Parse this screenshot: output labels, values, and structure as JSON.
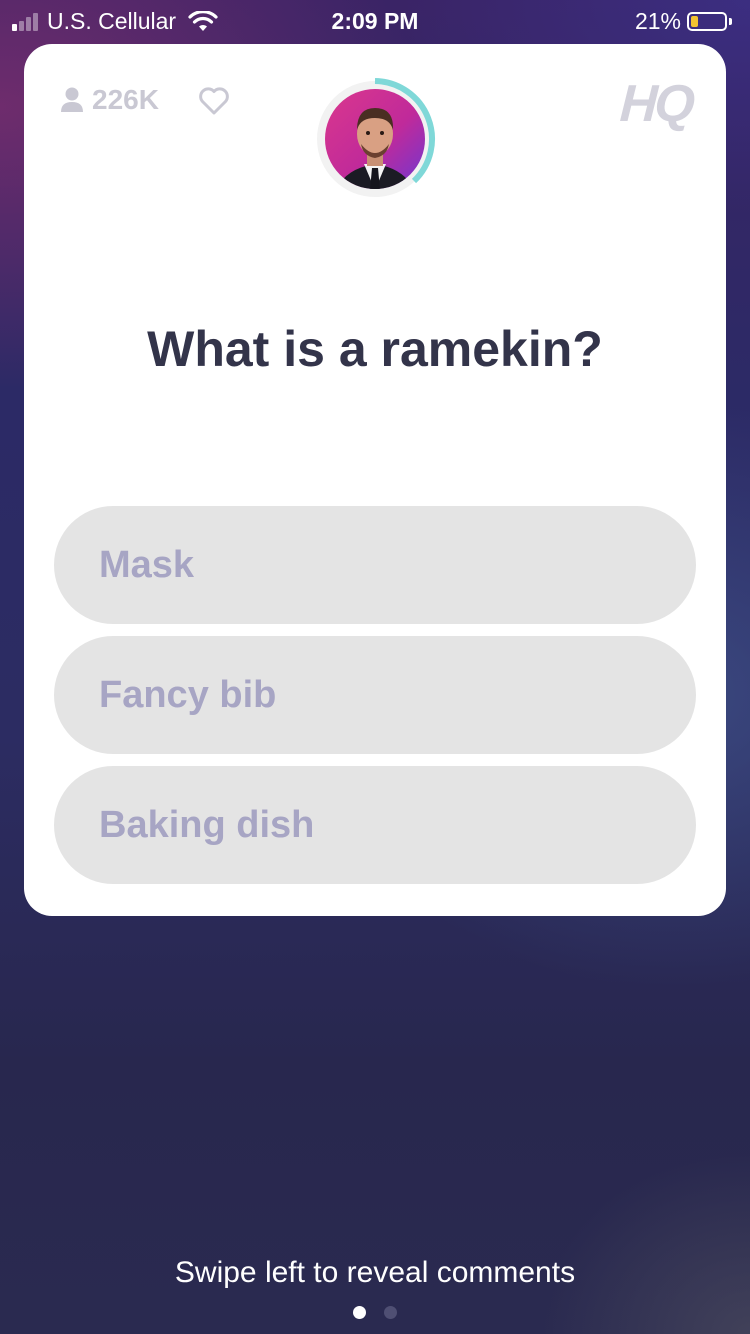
{
  "status_bar": {
    "carrier": "U.S. Cellular",
    "time": "2:09 PM",
    "battery_percent": "21%",
    "battery_level": 0.21,
    "signal_bars": 4,
    "signal_active": 1,
    "wifi_icon": "wifi-icon"
  },
  "game": {
    "viewer_count": "226K",
    "viewer_icon": "person-icon",
    "heart_icon": "heart-icon",
    "logo": "HQ",
    "host_avatar_icon": "host-avatar",
    "timer_ring_color": "#7fd8d8",
    "question": "What is a ramekin?",
    "answers": [
      {
        "label": "Mask"
      },
      {
        "label": "Fancy bib"
      },
      {
        "label": "Baking dish"
      }
    ]
  },
  "footer": {
    "hint": "Swipe left to reveal comments",
    "pages": 2,
    "active_page": 1
  },
  "colors": {
    "card_bg": "#ffffff",
    "answer_bg": "#e4e4e4",
    "answer_text": "#a7a5c4",
    "question_text": "#33344a",
    "battery_fill": "#f2c22f"
  }
}
